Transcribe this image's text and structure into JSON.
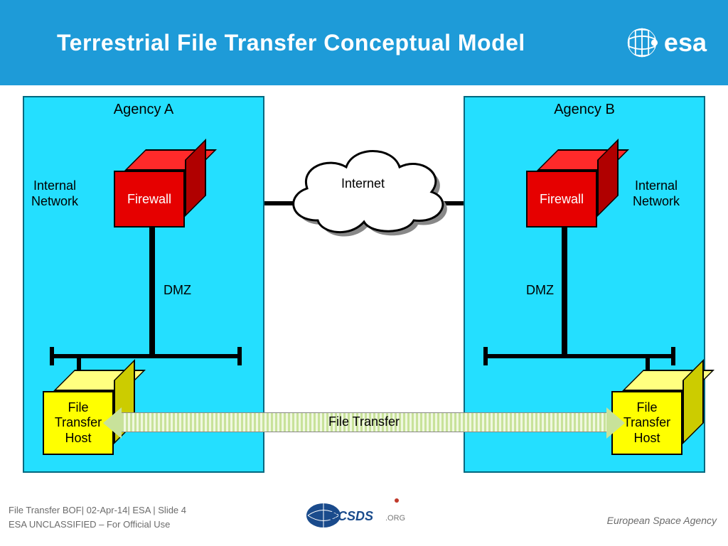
{
  "header": {
    "title": "Terrestrial File Transfer Conceptual Model",
    "logo_text": "esa"
  },
  "diagram": {
    "agency_a": "Agency A",
    "agency_b": "Agency B",
    "firewall": "Firewall",
    "internal_network": "Internal\nNetwork",
    "dmz": "DMZ",
    "internet": "Internet",
    "file_transfer_host": "File\nTransfer\nHost",
    "file_transfer": "File Transfer"
  },
  "footer": {
    "line1": "File Transfer BOF| 02-Apr-14| ESA | Slide  4",
    "line2": "ESA UNCLASSIFIED – For Official Use",
    "center_logo": "CCSDS.org",
    "right": "European Space Agency"
  }
}
